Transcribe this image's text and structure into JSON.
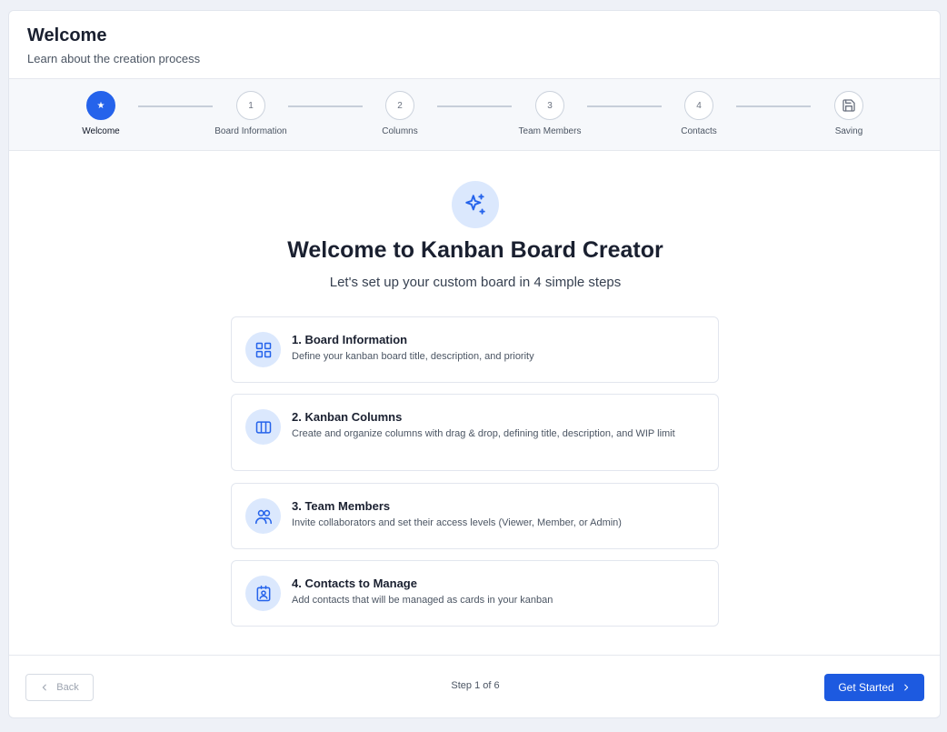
{
  "header": {
    "title": "Welcome",
    "subtitle": "Learn about the creation process"
  },
  "stepper": {
    "steps": [
      {
        "marker": "★",
        "label": "Welcome",
        "active": true
      },
      {
        "marker": "1",
        "label": "Board Information",
        "active": false
      },
      {
        "marker": "2",
        "label": "Columns",
        "active": false
      },
      {
        "marker": "3",
        "label": "Team Members",
        "active": false
      },
      {
        "marker": "4",
        "label": "Contacts",
        "active": false
      },
      {
        "marker": "save-icon",
        "label": "Saving",
        "active": false
      }
    ]
  },
  "hero": {
    "icon": "sparkles-icon",
    "title": "Welcome to Kanban Board Creator",
    "subtitle": "Let's set up your custom board in 4 simple steps"
  },
  "cards": [
    {
      "icon": "grid-icon",
      "title": "1. Board Information",
      "description": "Define your kanban board title, description, and priority"
    },
    {
      "icon": "columns-icon",
      "title": "2. Kanban Columns",
      "description": "Create and organize columns with drag & drop, defining title, description, and WIP limit"
    },
    {
      "icon": "users-icon",
      "title": "3. Team Members",
      "description": "Invite collaborators and set their access levels (Viewer, Member, or Admin)"
    },
    {
      "icon": "contact-icon",
      "title": "4. Contacts to Manage",
      "description": "Add contacts that will be managed as cards in your kanban"
    }
  ],
  "footer": {
    "back_label": "Back",
    "step_text": "Step 1 of 6",
    "next_label": "Get Started"
  },
  "colors": {
    "accent": "#2563eb",
    "icon_bg": "#dbe8fd"
  }
}
